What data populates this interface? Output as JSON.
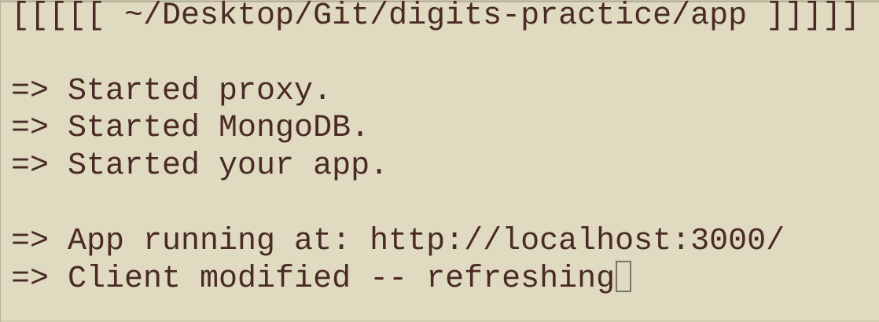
{
  "terminal": {
    "prompt_path": "[[[[[ ~/Desktop/Git/digits-practice/app ]]]]]",
    "lines": [
      "=> Started proxy.",
      "=> Started MongoDB.",
      "=> Started your app.",
      "=> App running at: http://localhost:3000/",
      "=> Client modified -- refreshing"
    ]
  },
  "colors": {
    "background": "#e0dac0",
    "text": "#4a2a26"
  }
}
